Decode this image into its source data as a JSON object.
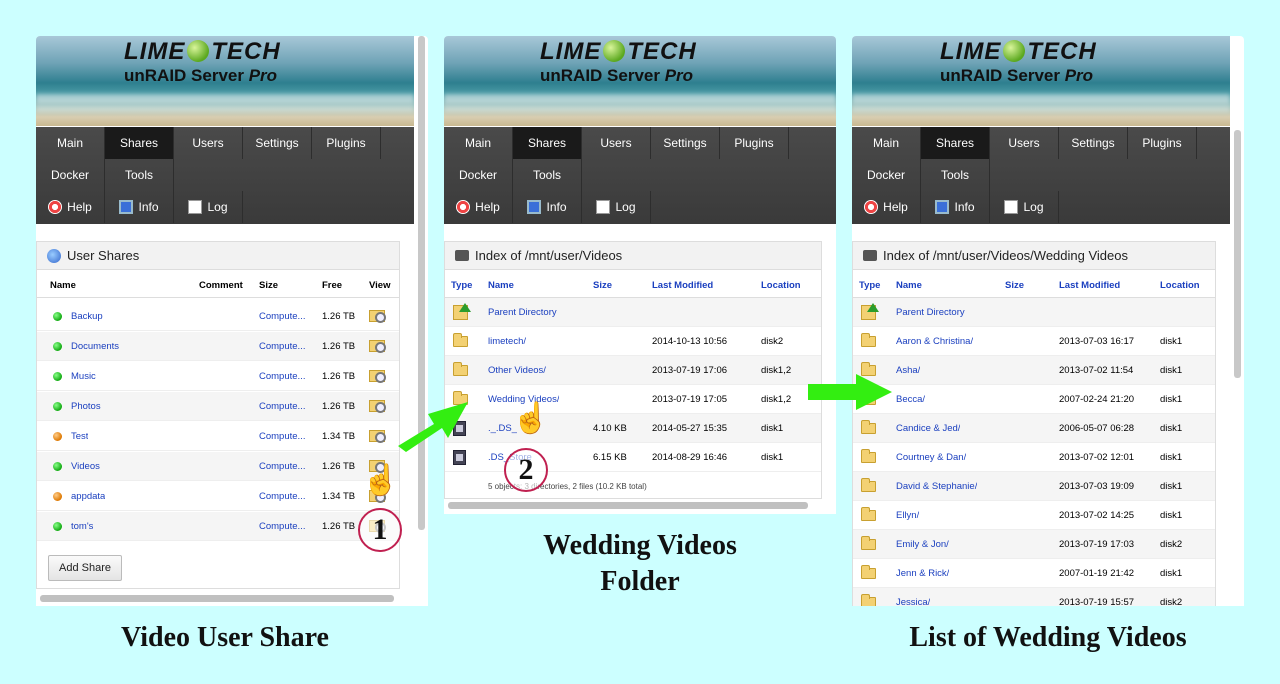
{
  "branding": {
    "brand_left": "LIME",
    "brand_right": "TECH",
    "product": "unRAID Server",
    "product_edition": "Pro"
  },
  "nav": {
    "main": "Main",
    "shares": "Shares",
    "users": "Users",
    "settings": "Settings",
    "plugins": "Plugins",
    "docker": "Docker",
    "tools": "Tools",
    "help": "Help",
    "info": "Info",
    "log": "Log"
  },
  "panel1": {
    "title": "User Shares",
    "columns": {
      "name": "Name",
      "comment": "Comment",
      "size": "Size",
      "free": "Free",
      "view": "View"
    },
    "rows": [
      {
        "name": "Backup",
        "size": "Compute...",
        "free": "1.26 TB",
        "status": "green"
      },
      {
        "name": "Documents",
        "size": "Compute...",
        "free": "1.26 TB",
        "status": "green"
      },
      {
        "name": "Music",
        "size": "Compute...",
        "free": "1.26 TB",
        "status": "green"
      },
      {
        "name": "Photos",
        "size": "Compute...",
        "free": "1.26 TB",
        "status": "green"
      },
      {
        "name": "Test",
        "size": "Compute...",
        "free": "1.34 TB",
        "status": "orange"
      },
      {
        "name": "Videos",
        "size": "Compute...",
        "free": "1.26 TB",
        "status": "green"
      },
      {
        "name": "appdata",
        "size": "Compute...",
        "free": "1.34 TB",
        "status": "orange"
      },
      {
        "name": "tom's",
        "size": "Compute...",
        "free": "1.26 TB",
        "status": "green"
      }
    ],
    "add_share": "Add Share",
    "caption": "Video User Share",
    "step": "1"
  },
  "panel2": {
    "title": "Index of /mnt/user/Videos",
    "columns": {
      "type": "Type",
      "name": "Name",
      "size": "Size",
      "modified": "Last Modified",
      "location": "Location"
    },
    "rows": [
      {
        "type": "up",
        "name": "Parent Directory",
        "size": "",
        "modified": "",
        "location": ""
      },
      {
        "type": "folder",
        "name": "limetech/",
        "size": "",
        "modified": "2014-10-13 10:56",
        "location": "disk2"
      },
      {
        "type": "folder",
        "name": "Other Videos/",
        "size": "",
        "modified": "2013-07-19 17:06",
        "location": "disk1,2"
      },
      {
        "type": "folder",
        "name": "Wedding Videos/",
        "size": "",
        "modified": "2013-07-19 17:05",
        "location": "disk1,2"
      },
      {
        "type": "file",
        "name": "._.DS_",
        "size": "4.10 KB",
        "modified": "2014-05-27 15:35",
        "location": "disk1"
      },
      {
        "type": "file",
        "name": ".DS_Store",
        "size": "6.15 KB",
        "modified": "2014-08-29 16:46",
        "location": "disk1"
      }
    ],
    "summary": "5 objects: 3 directories, 2 files (10.2 KB total)",
    "caption_line1": "Wedding Videos",
    "caption_line2": "Folder",
    "step": "2"
  },
  "panel3": {
    "title": "Index of /mnt/user/Videos/Wedding Videos",
    "columns": {
      "type": "Type",
      "name": "Name",
      "size": "Size",
      "modified": "Last Modified",
      "location": "Location"
    },
    "rows": [
      {
        "type": "up",
        "name": "Parent Directory",
        "modified": "",
        "location": ""
      },
      {
        "type": "folder",
        "name": "Aaron & Christina/",
        "modified": "2013-07-03 16:17",
        "location": "disk1"
      },
      {
        "type": "folder",
        "name": "Asha/",
        "modified": "2013-07-02 11:54",
        "location": "disk1"
      },
      {
        "type": "folder",
        "name": "Becca/",
        "modified": "2007-02-24 21:20",
        "location": "disk1"
      },
      {
        "type": "folder",
        "name": "Candice & Jed/",
        "modified": "2006-05-07 06:28",
        "location": "disk1"
      },
      {
        "type": "folder",
        "name": "Courtney & Dan/",
        "modified": "2013-07-02 12:01",
        "location": "disk1"
      },
      {
        "type": "folder",
        "name": "David & Stephanie/",
        "modified": "2013-07-03 19:09",
        "location": "disk1"
      },
      {
        "type": "folder",
        "name": "Ellyn/",
        "modified": "2013-07-02 14:25",
        "location": "disk1"
      },
      {
        "type": "folder",
        "name": "Emily & Jon/",
        "modified": "2013-07-19 17:03",
        "location": "disk2"
      },
      {
        "type": "folder",
        "name": "Jenn & Rick/",
        "modified": "2007-01-19 21:42",
        "location": "disk1"
      },
      {
        "type": "folder",
        "name": "Jessica/",
        "modified": "2013-07-19 15:57",
        "location": "disk2"
      }
    ],
    "caption": "List of Wedding Videos"
  },
  "colors": {
    "background": "#ccffff",
    "nav": "#3e3e3e",
    "link": "#1a3fbf",
    "arrow": "#33ee11",
    "badge_ring": "#c02050"
  }
}
